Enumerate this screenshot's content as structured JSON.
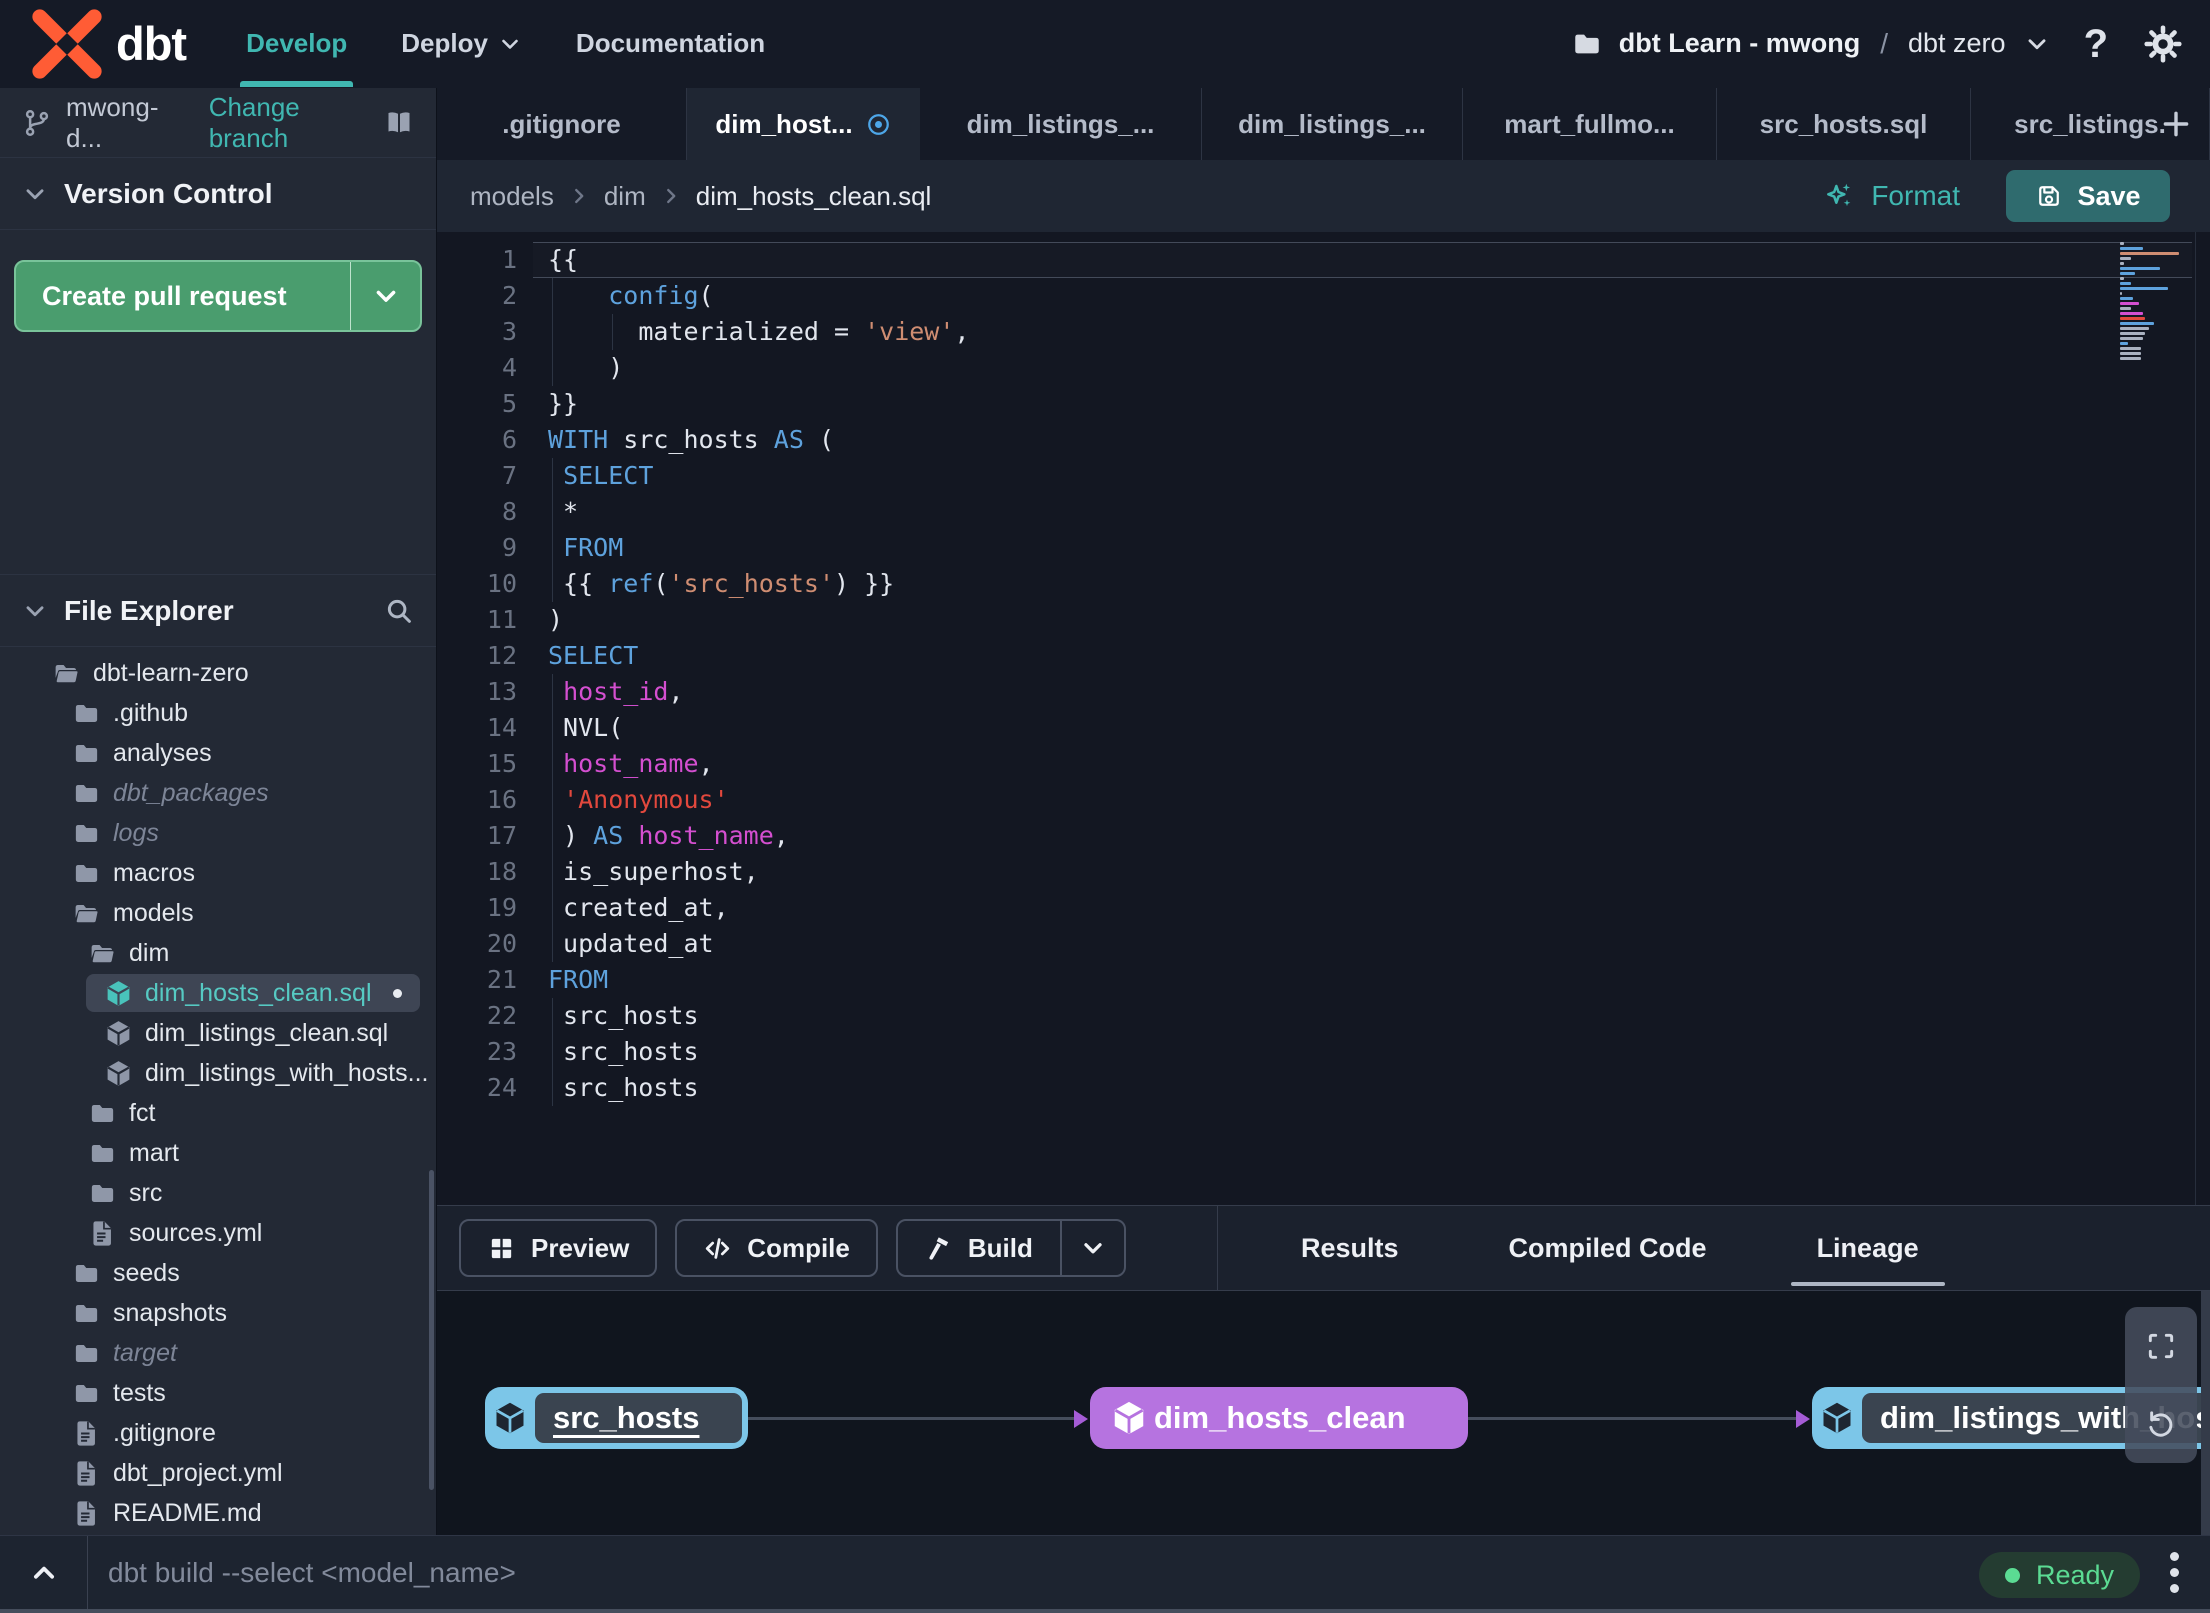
{
  "navbar": {
    "brand": "dbt",
    "items": [
      {
        "label": "Develop",
        "active": true
      },
      {
        "label": "Deploy",
        "has_chevron": true
      },
      {
        "label": "Documentation"
      }
    ],
    "project": {
      "name": "dbt Learn - mwong",
      "separator": "/",
      "environment": "dbt zero"
    },
    "help_label": "?"
  },
  "sidebar": {
    "branch": {
      "name": "mwong-d...",
      "action": "Change branch"
    },
    "version_control": {
      "title": "Version Control",
      "create_pr_label": "Create pull request"
    },
    "file_explorer": {
      "title": "File Explorer",
      "tree": [
        {
          "label": "dbt-learn-zero",
          "type": "folder-open",
          "level": 0
        },
        {
          "label": ".github",
          "type": "folder",
          "level": 1
        },
        {
          "label": "analyses",
          "type": "folder",
          "level": 1
        },
        {
          "label": "dbt_packages",
          "type": "folder",
          "level": 1,
          "muted": true
        },
        {
          "label": "logs",
          "type": "folder",
          "level": 1,
          "muted": true
        },
        {
          "label": "macros",
          "type": "folder",
          "level": 1
        },
        {
          "label": "models",
          "type": "folder-open",
          "level": 1
        },
        {
          "label": "dim",
          "type": "folder-open",
          "level": 2
        },
        {
          "label": "dim_hosts_clean.sql",
          "type": "model",
          "level": 3,
          "selected": true,
          "modified": true
        },
        {
          "label": "dim_listings_clean.sql",
          "type": "model",
          "level": 3
        },
        {
          "label": "dim_listings_with_hosts...",
          "type": "model",
          "level": 3
        },
        {
          "label": "fct",
          "type": "folder",
          "level": 2
        },
        {
          "label": "mart",
          "type": "folder",
          "level": 2
        },
        {
          "label": "src",
          "type": "folder",
          "level": 2
        },
        {
          "label": "sources.yml",
          "type": "file",
          "level": 2
        },
        {
          "label": "seeds",
          "type": "folder",
          "level": 1
        },
        {
          "label": "snapshots",
          "type": "folder",
          "level": 1
        },
        {
          "label": "target",
          "type": "folder",
          "level": 1,
          "muted": true
        },
        {
          "label": "tests",
          "type": "folder",
          "level": 1
        },
        {
          "label": ".gitignore",
          "type": "file",
          "level": 1
        },
        {
          "label": "dbt_project.yml",
          "type": "file",
          "level": 1
        },
        {
          "label": "README.md",
          "type": "file",
          "level": 1
        }
      ]
    }
  },
  "tabs": [
    {
      "label": ".gitignore"
    },
    {
      "label": "dim_host...",
      "active": true,
      "modified": true
    },
    {
      "label": "dim_listings_..."
    },
    {
      "label": "dim_listings_..."
    },
    {
      "label": "mart_fullmo..."
    },
    {
      "label": "src_hosts.sql"
    },
    {
      "label": "src_listings."
    }
  ],
  "toolbar": {
    "breadcrumb": [
      "models",
      "dim",
      "dim_hosts_clean.sql"
    ],
    "format_label": "Format",
    "save_label": "Save"
  },
  "editor": {
    "lines": [
      {
        "n": 1,
        "active": true,
        "t": [
          [
            "{{",
            "fg"
          ]
        ]
      },
      {
        "n": 2,
        "t": [
          [
            "    ",
            "fg"
          ],
          [
            "config",
            "k"
          ],
          [
            "(",
            "fg"
          ]
        ]
      },
      {
        "n": 3,
        "t": [
          [
            "      ",
            "fg"
          ],
          [
            "materialized = ",
            "fg"
          ],
          [
            "'view'",
            "s"
          ],
          [
            ",",
            "fg"
          ]
        ]
      },
      {
        "n": 4,
        "t": [
          [
            "    )",
            "fg"
          ]
        ]
      },
      {
        "n": 5,
        "t": [
          [
            "}}",
            "fg"
          ]
        ]
      },
      {
        "n": 6,
        "t": [
          [
            "WITH",
            "k"
          ],
          [
            " src_hosts ",
            "fg"
          ],
          [
            "AS",
            "k"
          ],
          [
            " (",
            "fg"
          ]
        ]
      },
      {
        "n": 7,
        "t": [
          [
            " ",
            "fg"
          ],
          [
            "SELECT",
            "k"
          ]
        ]
      },
      {
        "n": 8,
        "t": [
          [
            " *",
            "fg"
          ]
        ]
      },
      {
        "n": 9,
        "t": [
          [
            " ",
            "fg"
          ],
          [
            "FROM",
            "k"
          ]
        ]
      },
      {
        "n": 10,
        "t": [
          [
            " {{ ",
            "fg"
          ],
          [
            "ref",
            "k"
          ],
          [
            "(",
            "fg"
          ],
          [
            "'src_hosts'",
            "s"
          ],
          [
            ") }}",
            "fg"
          ]
        ]
      },
      {
        "n": 11,
        "t": [
          [
            ")",
            "fg"
          ]
        ]
      },
      {
        "n": 12,
        "t": [
          [
            "SELECT",
            "k"
          ]
        ]
      },
      {
        "n": 13,
        "t": [
          [
            " ",
            "fg"
          ],
          [
            "host_id",
            "v"
          ],
          [
            ",",
            "fg"
          ]
        ]
      },
      {
        "n": 14,
        "t": [
          [
            " NVL(",
            "fg"
          ]
        ]
      },
      {
        "n": 15,
        "t": [
          [
            " ",
            "fg"
          ],
          [
            "host_name",
            "v"
          ],
          [
            ",",
            "fg"
          ]
        ]
      },
      {
        "n": 16,
        "t": [
          [
            " ",
            "fg"
          ],
          [
            "'Anonymous'",
            "r"
          ]
        ]
      },
      {
        "n": 17,
        "t": [
          [
            " ) ",
            "fg"
          ],
          [
            "AS",
            "k"
          ],
          [
            " ",
            "fg"
          ],
          [
            "host_name",
            "v"
          ],
          [
            ",",
            "fg"
          ]
        ]
      },
      {
        "n": 18,
        "t": [
          [
            " is_superhost,",
            "fg"
          ]
        ]
      },
      {
        "n": 19,
        "t": [
          [
            " created_at,",
            "fg"
          ]
        ]
      },
      {
        "n": 20,
        "t": [
          [
            " updated_at",
            "fg"
          ]
        ]
      },
      {
        "n": 21,
        "t": [
          [
            "FROM",
            "k"
          ]
        ]
      },
      {
        "n": 22,
        "t": [
          [
            " src_hosts",
            "fg"
          ]
        ]
      },
      {
        "n": 23,
        "t": [
          [
            " src_hosts",
            "fg"
          ]
        ]
      },
      {
        "n": 24,
        "t": [
          [
            " src_hosts",
            "fg"
          ]
        ]
      }
    ]
  },
  "actions": {
    "preview_label": "Preview",
    "compile_label": "Compile",
    "build_label": "Build",
    "tabs": [
      {
        "label": "Results"
      },
      {
        "label": "Compiled Code"
      },
      {
        "label": "Lineage",
        "active": true
      }
    ]
  },
  "lineage": {
    "nodes": [
      {
        "label": "src_hosts",
        "variant": "source",
        "underlined": true
      },
      {
        "label": "dim_hosts_clean",
        "variant": "model"
      },
      {
        "label": "dim_listings_with_hosts",
        "variant": "source"
      }
    ]
  },
  "statusbar": {
    "command": "dbt build --select <model_name>",
    "status": "Ready"
  },
  "colors": {
    "accent_teal": "#40b7b1",
    "node_blue": "#7cc6e8",
    "node_purple": "#b673e0",
    "arrow_purple": "#a55cd6",
    "ready_green": "#5bdb93",
    "pr_green": "#4a9d6e",
    "save_teal": "#2f6b6e",
    "modified_blue": "#4da6e8",
    "logo_orange": "#ff5c35"
  }
}
